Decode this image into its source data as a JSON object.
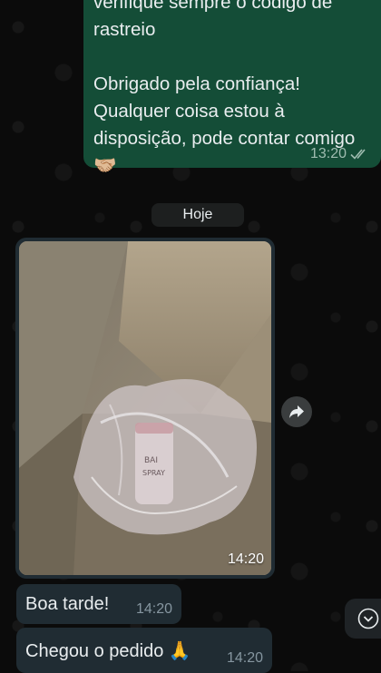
{
  "outgoing_message": {
    "text": "verifique sempre o código de rastreio\n\nObrigado pela confiança! Qualquer coisa estou à disposição, pode contar comigo 🤝🏼",
    "time": "13:20",
    "status_icon": "double-check-icon"
  },
  "date_separator": {
    "label": "Hoje"
  },
  "image_message": {
    "time": "14:20",
    "photo_label_lines": [
      "BAI",
      "SPRAY"
    ]
  },
  "incoming_messages": [
    {
      "text": "Boa tarde!",
      "time": "14:20"
    },
    {
      "text": "Chegou o pedido 🙏",
      "time": "14:20"
    }
  ],
  "icons": {
    "forward": "forward-arrow-icon",
    "scroll_down": "chevron-down-icon"
  },
  "colors": {
    "outgoing_bubble": "#144d37",
    "incoming_bubble": "#202c33",
    "background": "#0b0b0b"
  }
}
